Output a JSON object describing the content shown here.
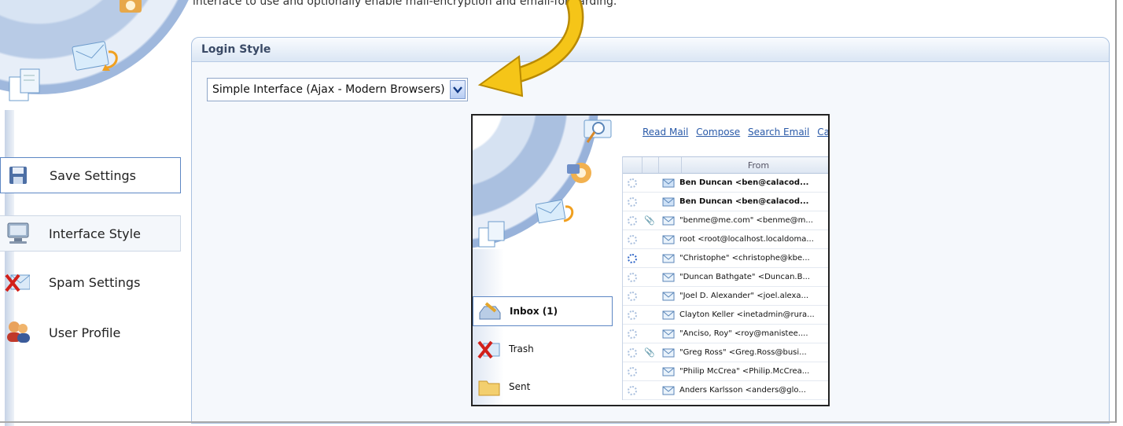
{
  "intro_text": "interface to use and optionally enable mail-encryption and email-forwarding.",
  "sidebar": {
    "items": [
      {
        "label": "Save Settings",
        "icon": "floppy-disk-icon"
      },
      {
        "label": "Interface Style",
        "icon": "monitor-icon"
      },
      {
        "label": "Spam Settings",
        "icon": "spam-mail-icon"
      },
      {
        "label": "User Profile",
        "icon": "users-icon"
      }
    ]
  },
  "panel": {
    "title": "Login Style",
    "select_value": "Simple Interface (Ajax - Modern Browsers)"
  },
  "preview": {
    "links": [
      "Read Mail",
      "Compose",
      "Search Email",
      "Cal"
    ],
    "column_from": "From",
    "folders": [
      {
        "label": "Inbox (1)",
        "icon": "inbox-icon"
      },
      {
        "label": "Trash",
        "icon": "trash-icon"
      },
      {
        "label": "Sent",
        "icon": "sent-folder-icon"
      }
    ],
    "messages": [
      {
        "from": "Ben Duncan <ben@calacod...",
        "unread": true,
        "attach": false
      },
      {
        "from": "Ben Duncan <ben@calacod...",
        "unread": true,
        "attach": false
      },
      {
        "from": "\"benme@me.com\" <benme@m...",
        "unread": false,
        "attach": true
      },
      {
        "from": "root <root@localhost.localdoma...",
        "unread": false,
        "attach": false
      },
      {
        "from": "\"Christophe\" <christophe@kbe...",
        "unread": false,
        "attach": false
      },
      {
        "from": "\"Duncan Bathgate\" <Duncan.B...",
        "unread": false,
        "attach": false
      },
      {
        "from": "\"Joel D. Alexander\" <joel.alexa...",
        "unread": false,
        "attach": false
      },
      {
        "from": "Clayton Keller <inetadmin@rura...",
        "unread": false,
        "attach": false
      },
      {
        "from": "\"Anciso, Roy\" <roy@manistee....",
        "unread": false,
        "attach": false
      },
      {
        "from": "\"Greg Ross\" <Greg.Ross@busi...",
        "unread": false,
        "attach": true
      },
      {
        "from": "\"Philip McCrea\" <Philip.McCrea...",
        "unread": false,
        "attach": false
      },
      {
        "from": "Anders Karlsson <anders@glo...",
        "unread": false,
        "attach": false
      }
    ]
  },
  "colors": {
    "accent_border": "#5d87c4",
    "panel_bg": "#f5f8fc",
    "arrow": "#f2c314",
    "link": "#2a5aa8"
  }
}
